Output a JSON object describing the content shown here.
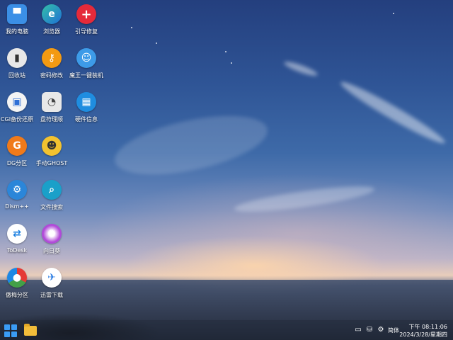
{
  "desktop": {
    "icons": [
      {
        "label": "我的电脑",
        "icon": "computer-folder-icon",
        "color": "#3b8fe6"
      },
      {
        "label": "浏览器",
        "icon": "edge-browser-icon",
        "color": "#1e88d6"
      },
      {
        "label": "引导修复",
        "icon": "plus-repair-icon",
        "color": "#e52a3a"
      },
      {
        "label": "回收站",
        "icon": "recycle-bin-icon",
        "color": "#3a3a3a"
      },
      {
        "label": "密码修改",
        "icon": "key-icon",
        "color": "#f39a12"
      },
      {
        "label": "魔王一键装机",
        "icon": "ghost-installer-icon",
        "color": "#3d9be8"
      },
      {
        "label": "CGI备份还原",
        "icon": "cgi-backup-icon",
        "color": "#f4f4f4"
      },
      {
        "label": "盘符理顺",
        "icon": "disk-sort-icon",
        "color": "#e8e8e8"
      },
      {
        "label": "硬件信息",
        "icon": "hardware-info-icon",
        "color": "#1f8de0"
      },
      {
        "label": "DG分区",
        "icon": "dg-partition-icon",
        "color": "#f07a1a"
      },
      {
        "label": "手动GHOST",
        "icon": "ghost-icon",
        "color": "#f2c230"
      },
      {
        "label": "Dism++",
        "icon": "dism-gear-icon",
        "color": "#2b86d9"
      },
      {
        "label": "文件搜索",
        "icon": "search-icon",
        "color": "#1aa0c9"
      },
      {
        "label": "ToDesk",
        "icon": "todesk-icon",
        "color": "#1a7fe0"
      },
      {
        "label": "向日葵",
        "icon": "sunflower-icon",
        "color": "#b04ad8"
      },
      {
        "label": "傲梅分区",
        "icon": "aomei-partition-icon",
        "color": "#ffffff"
      },
      {
        "label": "迅雷下载",
        "icon": "thunder-download-icon",
        "color": "#2f7fe3"
      }
    ]
  },
  "taskbar": {
    "start_icon": "windows-start-icon",
    "explorer_icon": "file-explorer-icon",
    "tray_icons": [
      "network-icon",
      "usb-safe-remove-icon",
      "settings-gear-icon"
    ],
    "language": "简体",
    "time": "下午 08:11:06",
    "date": "2024/3/28/星期四"
  }
}
